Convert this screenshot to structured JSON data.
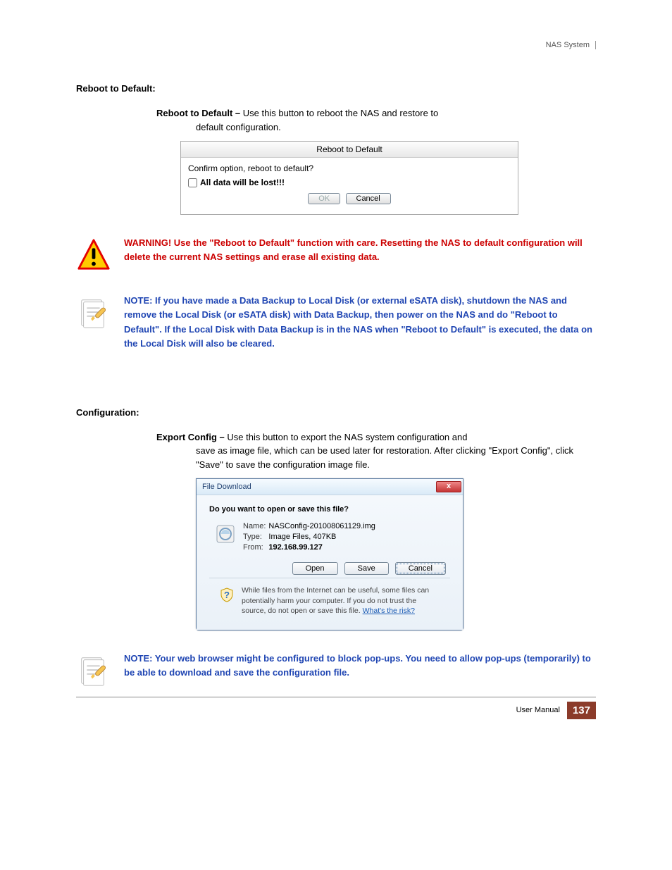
{
  "header": {
    "text": "NAS System"
  },
  "sections": {
    "reboot_heading": "Reboot to Default:",
    "reboot_bold": "Reboot to Default –",
    "reboot_desc": " Use this button to reboot the NAS and restore to",
    "reboot_desc2": "default configuration.",
    "config_heading": "Configuration:",
    "export_bold": "Export Config –",
    "export_desc": " Use this button to export the NAS system configuration and",
    "export_desc2": "save as image file, which can be used later for restoration. After clicking \"Export Config\", click \"Save\" to save the configuration image file."
  },
  "reboot_dialog": {
    "title": "Reboot to Default",
    "confirm": "Confirm option, reboot to default?",
    "checkbox_label": "All data will be lost!!!",
    "ok": "OK",
    "cancel": "Cancel"
  },
  "warning": {
    "text": "WARNING! Use the \"Reboot to Default\" function with care. Resetting the NAS to default configuration will delete the current NAS settings and erase all existing data."
  },
  "note1": {
    "text": "NOTE: If you have made a Data Backup to Local Disk (or external eSATA disk), shutdown the NAS and remove the Local Disk (or eSATA disk) with Data Backup, then power on the NAS and do \"Reboot to Default\". If the Local Disk with Data Backup is in the NAS when \"Reboot to Default\" is executed, the data on the Local Disk will also be cleared."
  },
  "file_dialog": {
    "title": "File Download",
    "question": "Do you want to open or save this file?",
    "name_label": "Name:",
    "name_value": "NASConfig-201008061129.img",
    "type_label": "Type:",
    "type_value": "Image Files, 407KB",
    "from_label": "From:",
    "from_value": "192.168.99.127",
    "open": "Open",
    "save": "Save",
    "cancel": "Cancel",
    "footer_text": "While files from the Internet can be useful, some files can potentially harm your computer. If you do not trust the source, do not open or save this file. ",
    "footer_link": "What's the risk?"
  },
  "note2": {
    "text": "NOTE: Your web browser might be configured to block pop-ups. You need to allow pop-ups (temporarily) to be able to download and save the configuration file."
  },
  "footer": {
    "label": "User Manual",
    "page": "137"
  }
}
